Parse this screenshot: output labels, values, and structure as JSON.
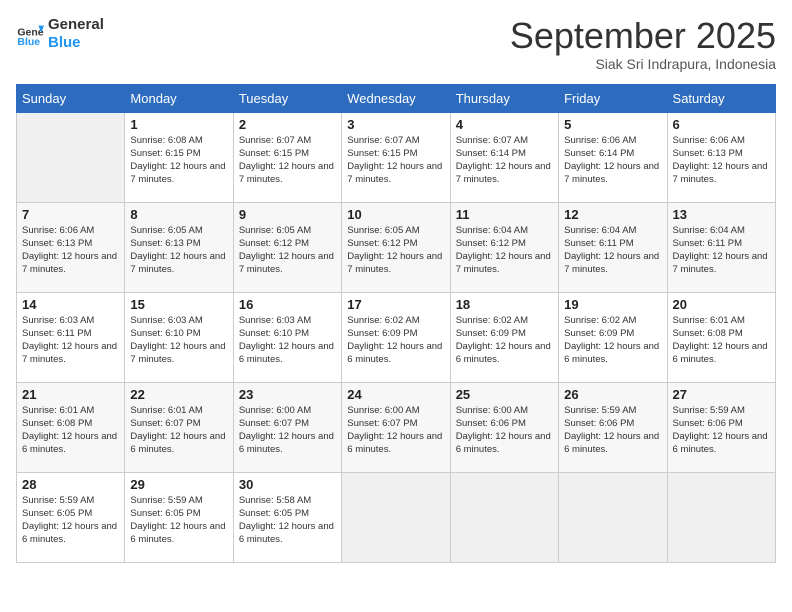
{
  "logo": {
    "line1": "General",
    "line2": "Blue"
  },
  "title": "September 2025",
  "subtitle": "Siak Sri Indrapura, Indonesia",
  "weekdays": [
    "Sunday",
    "Monday",
    "Tuesday",
    "Wednesday",
    "Thursday",
    "Friday",
    "Saturday"
  ],
  "weeks": [
    [
      {
        "day": "",
        "empty": true
      },
      {
        "day": "1",
        "sunrise": "6:08 AM",
        "sunset": "6:15 PM",
        "daylight": "12 hours and 7 minutes."
      },
      {
        "day": "2",
        "sunrise": "6:07 AM",
        "sunset": "6:15 PM",
        "daylight": "12 hours and 7 minutes."
      },
      {
        "day": "3",
        "sunrise": "6:07 AM",
        "sunset": "6:15 PM",
        "daylight": "12 hours and 7 minutes."
      },
      {
        "day": "4",
        "sunrise": "6:07 AM",
        "sunset": "6:14 PM",
        "daylight": "12 hours and 7 minutes."
      },
      {
        "day": "5",
        "sunrise": "6:06 AM",
        "sunset": "6:14 PM",
        "daylight": "12 hours and 7 minutes."
      },
      {
        "day": "6",
        "sunrise": "6:06 AM",
        "sunset": "6:13 PM",
        "daylight": "12 hours and 7 minutes."
      }
    ],
    [
      {
        "day": "7",
        "sunrise": "6:06 AM",
        "sunset": "6:13 PM",
        "daylight": "12 hours and 7 minutes."
      },
      {
        "day": "8",
        "sunrise": "6:05 AM",
        "sunset": "6:13 PM",
        "daylight": "12 hours and 7 minutes."
      },
      {
        "day": "9",
        "sunrise": "6:05 AM",
        "sunset": "6:12 PM",
        "daylight": "12 hours and 7 minutes."
      },
      {
        "day": "10",
        "sunrise": "6:05 AM",
        "sunset": "6:12 PM",
        "daylight": "12 hours and 7 minutes."
      },
      {
        "day": "11",
        "sunrise": "6:04 AM",
        "sunset": "6:12 PM",
        "daylight": "12 hours and 7 minutes."
      },
      {
        "day": "12",
        "sunrise": "6:04 AM",
        "sunset": "6:11 PM",
        "daylight": "12 hours and 7 minutes."
      },
      {
        "day": "13",
        "sunrise": "6:04 AM",
        "sunset": "6:11 PM",
        "daylight": "12 hours and 7 minutes."
      }
    ],
    [
      {
        "day": "14",
        "sunrise": "6:03 AM",
        "sunset": "6:11 PM",
        "daylight": "12 hours and 7 minutes."
      },
      {
        "day": "15",
        "sunrise": "6:03 AM",
        "sunset": "6:10 PM",
        "daylight": "12 hours and 7 minutes."
      },
      {
        "day": "16",
        "sunrise": "6:03 AM",
        "sunset": "6:10 PM",
        "daylight": "12 hours and 6 minutes."
      },
      {
        "day": "17",
        "sunrise": "6:02 AM",
        "sunset": "6:09 PM",
        "daylight": "12 hours and 6 minutes."
      },
      {
        "day": "18",
        "sunrise": "6:02 AM",
        "sunset": "6:09 PM",
        "daylight": "12 hours and 6 minutes."
      },
      {
        "day": "19",
        "sunrise": "6:02 AM",
        "sunset": "6:09 PM",
        "daylight": "12 hours and 6 minutes."
      },
      {
        "day": "20",
        "sunrise": "6:01 AM",
        "sunset": "6:08 PM",
        "daylight": "12 hours and 6 minutes."
      }
    ],
    [
      {
        "day": "21",
        "sunrise": "6:01 AM",
        "sunset": "6:08 PM",
        "daylight": "12 hours and 6 minutes."
      },
      {
        "day": "22",
        "sunrise": "6:01 AM",
        "sunset": "6:07 PM",
        "daylight": "12 hours and 6 minutes."
      },
      {
        "day": "23",
        "sunrise": "6:00 AM",
        "sunset": "6:07 PM",
        "daylight": "12 hours and 6 minutes."
      },
      {
        "day": "24",
        "sunrise": "6:00 AM",
        "sunset": "6:07 PM",
        "daylight": "12 hours and 6 minutes."
      },
      {
        "day": "25",
        "sunrise": "6:00 AM",
        "sunset": "6:06 PM",
        "daylight": "12 hours and 6 minutes."
      },
      {
        "day": "26",
        "sunrise": "5:59 AM",
        "sunset": "6:06 PM",
        "daylight": "12 hours and 6 minutes."
      },
      {
        "day": "27",
        "sunrise": "5:59 AM",
        "sunset": "6:06 PM",
        "daylight": "12 hours and 6 minutes."
      }
    ],
    [
      {
        "day": "28",
        "sunrise": "5:59 AM",
        "sunset": "6:05 PM",
        "daylight": "12 hours and 6 minutes."
      },
      {
        "day": "29",
        "sunrise": "5:59 AM",
        "sunset": "6:05 PM",
        "daylight": "12 hours and 6 minutes."
      },
      {
        "day": "30",
        "sunrise": "5:58 AM",
        "sunset": "6:05 PM",
        "daylight": "12 hours and 6 minutes."
      },
      {
        "day": "",
        "empty": true
      },
      {
        "day": "",
        "empty": true
      },
      {
        "day": "",
        "empty": true
      },
      {
        "day": "",
        "empty": true
      }
    ]
  ]
}
